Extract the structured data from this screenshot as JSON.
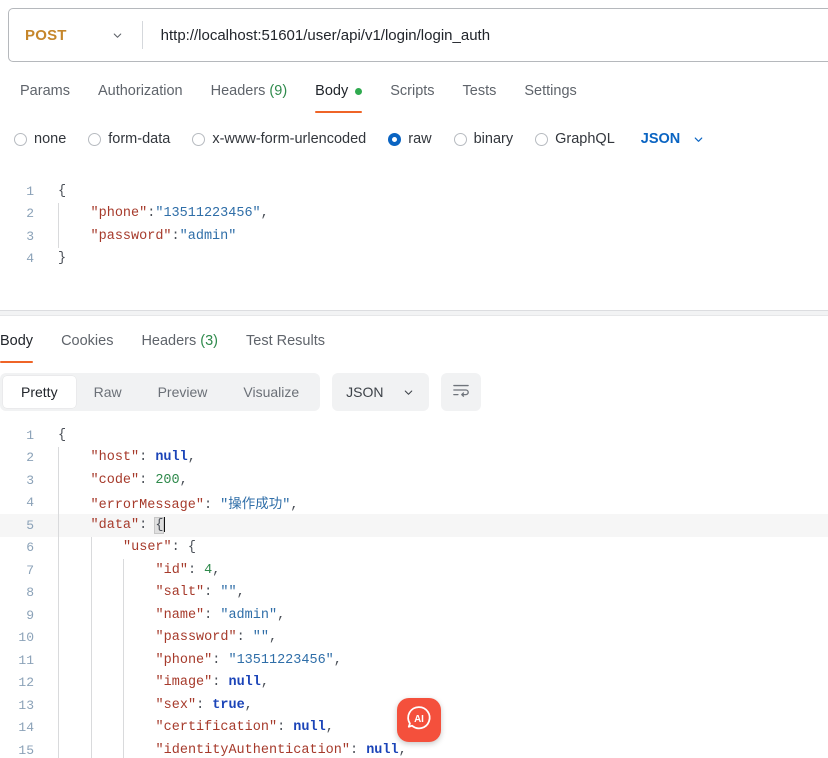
{
  "request": {
    "method": "POST",
    "url": "http://localhost:51601/user/api/v1/login/login_auth",
    "method_chevron_icon": "chevron-down-icon",
    "tabs": [
      {
        "label": "Params",
        "active": false
      },
      {
        "label": "Authorization",
        "active": false
      },
      {
        "label": "Headers",
        "count": "(9)",
        "active": false
      },
      {
        "label": "Body",
        "active": true,
        "dot": true
      },
      {
        "label": "Scripts",
        "active": false
      },
      {
        "label": "Tests",
        "active": false
      },
      {
        "label": "Settings",
        "active": false
      }
    ],
    "body_types": [
      {
        "label": "none",
        "selected": false
      },
      {
        "label": "form-data",
        "selected": false
      },
      {
        "label": "x-www-form-urlencoded",
        "selected": false
      },
      {
        "label": "raw",
        "selected": true
      },
      {
        "label": "binary",
        "selected": false
      },
      {
        "label": "GraphQL",
        "selected": false
      }
    ],
    "format": "JSON",
    "format_chevron_icon": "chevron-down-icon",
    "body_lines": [
      {
        "n": "1",
        "depth": 0,
        "tokens": [
          {
            "t": "brace",
            "v": "{"
          }
        ]
      },
      {
        "n": "2",
        "depth": 1,
        "tokens": [
          {
            "t": "key",
            "v": "\"phone\""
          },
          {
            "t": "punct",
            "v": ":"
          },
          {
            "t": "str",
            "v": "\"13511223456\""
          },
          {
            "t": "punct",
            "v": ","
          }
        ]
      },
      {
        "n": "3",
        "depth": 1,
        "tokens": [
          {
            "t": "key",
            "v": "\"password\""
          },
          {
            "t": "punct",
            "v": ":"
          },
          {
            "t": "str",
            "v": "\"admin\""
          }
        ]
      },
      {
        "n": "4",
        "depth": 0,
        "tokens": [
          {
            "t": "brace",
            "v": "}"
          }
        ]
      }
    ]
  },
  "response": {
    "tabs": [
      {
        "label": "Body",
        "active": true
      },
      {
        "label": "Cookies",
        "active": false
      },
      {
        "label": "Headers",
        "count": "(3)",
        "active": false
      },
      {
        "label": "Test Results",
        "active": false
      }
    ],
    "views": [
      {
        "label": "Pretty",
        "active": true
      },
      {
        "label": "Raw",
        "active": false
      },
      {
        "label": "Preview",
        "active": false
      },
      {
        "label": "Visualize",
        "active": false
      }
    ],
    "format": "JSON",
    "format_chevron_icon": "chevron-down-icon",
    "wrap_button_icon": "word-wrap-icon",
    "body_lines": [
      {
        "n": "1",
        "depth": 0,
        "highlight": false,
        "tokens": [
          {
            "t": "brace",
            "v": "{"
          }
        ]
      },
      {
        "n": "2",
        "depth": 1,
        "highlight": false,
        "tokens": [
          {
            "t": "key",
            "v": "\"host\""
          },
          {
            "t": "punct",
            "v": ": "
          },
          {
            "t": "lit",
            "v": "null"
          },
          {
            "t": "punct",
            "v": ","
          }
        ]
      },
      {
        "n": "3",
        "depth": 1,
        "highlight": false,
        "tokens": [
          {
            "t": "key",
            "v": "\"code\""
          },
          {
            "t": "punct",
            "v": ": "
          },
          {
            "t": "num",
            "v": "200"
          },
          {
            "t": "punct",
            "v": ","
          }
        ]
      },
      {
        "n": "4",
        "depth": 1,
        "highlight": false,
        "tokens": [
          {
            "t": "key",
            "v": "\"errorMessage\""
          },
          {
            "t": "punct",
            "v": ": "
          },
          {
            "t": "str",
            "v": "\"操作成功\""
          },
          {
            "t": "punct",
            "v": ","
          }
        ]
      },
      {
        "n": "5",
        "depth": 1,
        "highlight": true,
        "caret": true,
        "tokens": [
          {
            "t": "key",
            "v": "\"data\""
          },
          {
            "t": "punct",
            "v": ": "
          },
          {
            "t": "match",
            "v": "{"
          }
        ]
      },
      {
        "n": "6",
        "depth": 2,
        "highlight": false,
        "tokens": [
          {
            "t": "key",
            "v": "\"user\""
          },
          {
            "t": "punct",
            "v": ": "
          },
          {
            "t": "brace",
            "v": "{"
          }
        ]
      },
      {
        "n": "7",
        "depth": 3,
        "highlight": false,
        "tokens": [
          {
            "t": "key",
            "v": "\"id\""
          },
          {
            "t": "punct",
            "v": ": "
          },
          {
            "t": "num",
            "v": "4"
          },
          {
            "t": "punct",
            "v": ","
          }
        ]
      },
      {
        "n": "8",
        "depth": 3,
        "highlight": false,
        "tokens": [
          {
            "t": "key",
            "v": "\"salt\""
          },
          {
            "t": "punct",
            "v": ": "
          },
          {
            "t": "str",
            "v": "\"\""
          },
          {
            "t": "punct",
            "v": ","
          }
        ]
      },
      {
        "n": "9",
        "depth": 3,
        "highlight": false,
        "tokens": [
          {
            "t": "key",
            "v": "\"name\""
          },
          {
            "t": "punct",
            "v": ": "
          },
          {
            "t": "str",
            "v": "\"admin\""
          },
          {
            "t": "punct",
            "v": ","
          }
        ]
      },
      {
        "n": "10",
        "depth": 3,
        "highlight": false,
        "tokens": [
          {
            "t": "key",
            "v": "\"password\""
          },
          {
            "t": "punct",
            "v": ": "
          },
          {
            "t": "str",
            "v": "\"\""
          },
          {
            "t": "punct",
            "v": ","
          }
        ]
      },
      {
        "n": "11",
        "depth": 3,
        "highlight": false,
        "tokens": [
          {
            "t": "key",
            "v": "\"phone\""
          },
          {
            "t": "punct",
            "v": ": "
          },
          {
            "t": "str",
            "v": "\"13511223456\""
          },
          {
            "t": "punct",
            "v": ","
          }
        ]
      },
      {
        "n": "12",
        "depth": 3,
        "highlight": false,
        "tokens": [
          {
            "t": "key",
            "v": "\"image\""
          },
          {
            "t": "punct",
            "v": ": "
          },
          {
            "t": "lit",
            "v": "null"
          },
          {
            "t": "punct",
            "v": ","
          }
        ]
      },
      {
        "n": "13",
        "depth": 3,
        "highlight": false,
        "tokens": [
          {
            "t": "key",
            "v": "\"sex\""
          },
          {
            "t": "punct",
            "v": ": "
          },
          {
            "t": "lit",
            "v": "true"
          },
          {
            "t": "punct",
            "v": ","
          }
        ]
      },
      {
        "n": "14",
        "depth": 3,
        "highlight": false,
        "tokens": [
          {
            "t": "key",
            "v": "\"certification\""
          },
          {
            "t": "punct",
            "v": ": "
          },
          {
            "t": "lit",
            "v": "null"
          },
          {
            "t": "punct",
            "v": ","
          }
        ]
      },
      {
        "n": "15",
        "depth": 3,
        "highlight": false,
        "tokens": [
          {
            "t": "key",
            "v": "\"identityAuthentication\""
          },
          {
            "t": "punct",
            "v": ": "
          },
          {
            "t": "lit",
            "v": "null"
          },
          {
            "t": "punct",
            "v": ","
          }
        ]
      }
    ]
  },
  "ai_button": {
    "icon": "ai-assistant-icon",
    "label": "AI"
  },
  "colors": {
    "accent_orange": "#ef6427",
    "method_amber": "#c5862b",
    "radio_blue": "#0a64c2",
    "link_blue": "#0a64c2",
    "green": "#2faa4f",
    "ai_red": "#f4503c"
  }
}
